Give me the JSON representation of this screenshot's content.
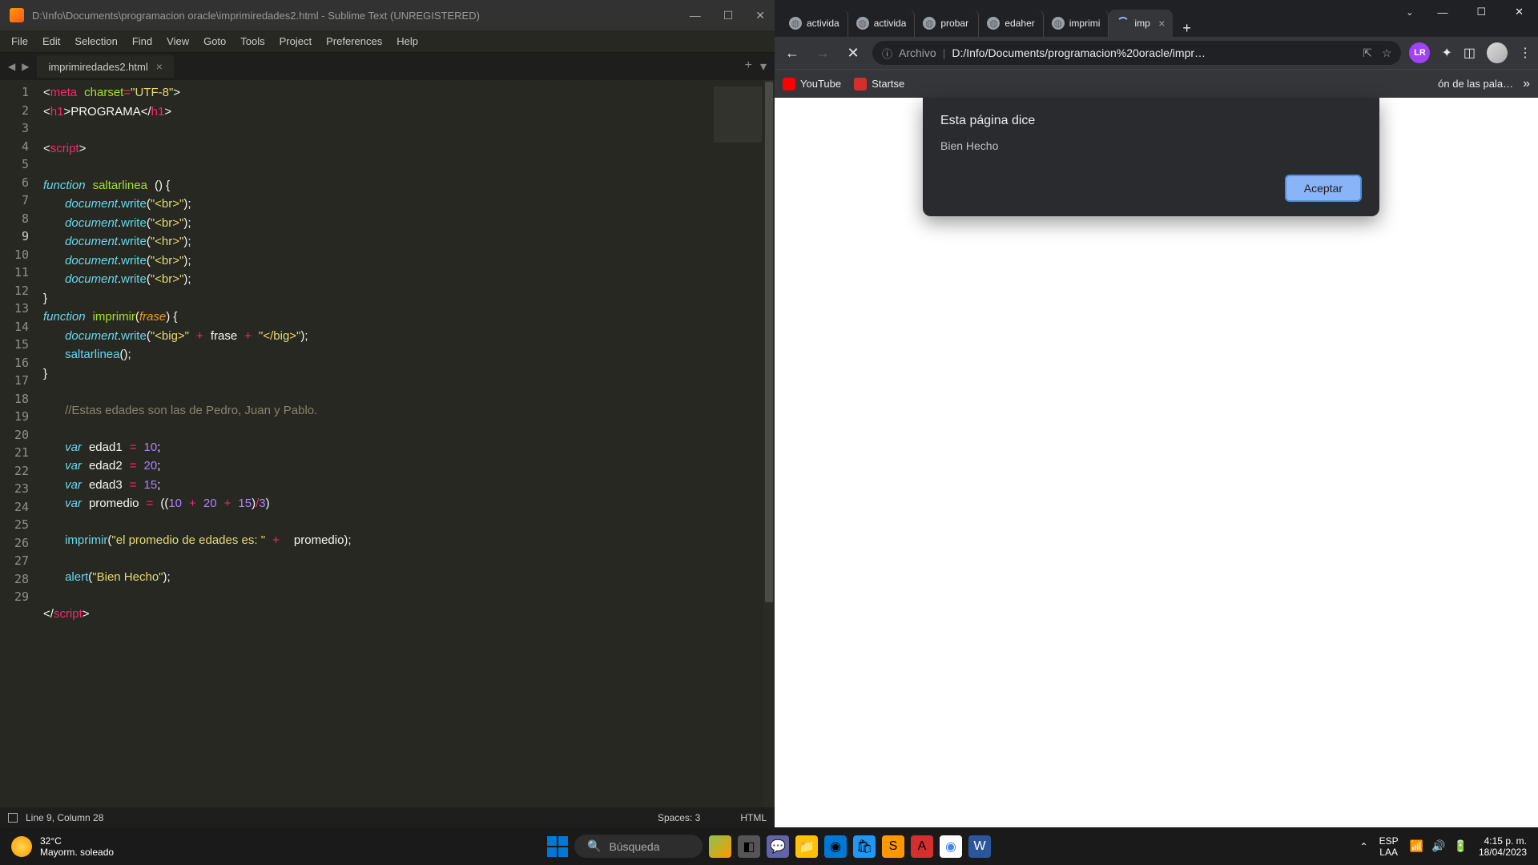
{
  "sublime": {
    "title": "D:\\Info\\Documents\\programacion oracle\\imprimiredades2.html - Sublime Text (UNREGISTERED)",
    "menu": [
      "File",
      "Edit",
      "Selection",
      "Find",
      "View",
      "Goto",
      "Tools",
      "Project",
      "Preferences",
      "Help"
    ],
    "tab": "imprimiredades2.html",
    "status_left": "Line 9, Column 28",
    "status_spaces": "Spaces: 3",
    "status_lang": "HTML",
    "win_min": "—",
    "win_max": "☐",
    "win_close": "✕"
  },
  "chrome": {
    "tabs": [
      {
        "label": "activida"
      },
      {
        "label": "activida"
      },
      {
        "label": "probar"
      },
      {
        "label": "edaher"
      },
      {
        "label": "imprimi"
      },
      {
        "label": "imp"
      }
    ],
    "addr_label": "Archivo",
    "addr_url": "D:/Info/Documents/programacion%20oracle/impr…",
    "bookmarks": {
      "youtube": "YouTube",
      "startse": "Startse",
      "pala": "ón de las pala…"
    },
    "dialog": {
      "title": "Esta página dice",
      "msg": "Bien Hecho",
      "accept": "Aceptar"
    },
    "win_min": "—",
    "win_max": "☐",
    "win_close": "✕",
    "avatar_letter": "LR"
  },
  "taskbar": {
    "temp": "32°C",
    "weather": "Mayorm. soleado",
    "search": "Búsqueda",
    "lang1": "ESP",
    "lang2": "LAA",
    "time": "4:15 p. m.",
    "date": "18/04/2023"
  }
}
